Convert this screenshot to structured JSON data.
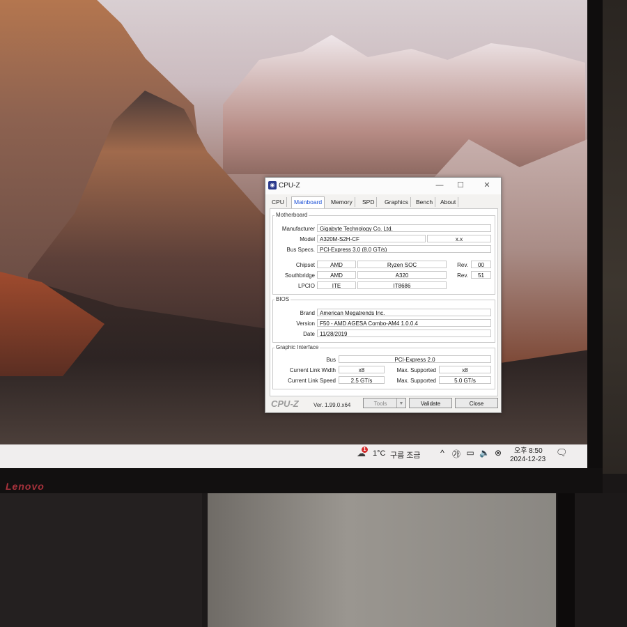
{
  "window": {
    "title": "CPU-Z",
    "app_icon": "cpuz-icon",
    "controls": {
      "minimize": "—",
      "maximize": "☐",
      "close": "✕"
    }
  },
  "tabs": [
    {
      "label": "CPU",
      "active": false
    },
    {
      "label": "Mainboard",
      "active": true
    },
    {
      "label": "Memory",
      "active": false
    },
    {
      "label": "SPD",
      "active": false
    },
    {
      "label": "Graphics",
      "active": false
    },
    {
      "label": "Bench",
      "active": false
    },
    {
      "label": "About",
      "active": false
    }
  ],
  "motherboard": {
    "title": "Motherboard",
    "manufacturer_label": "Manufacturer",
    "manufacturer": "Gigabyte Technology Co. Ltd.",
    "model_label": "Model",
    "model": "A320M-S2H-CF",
    "model_rev": "x.x",
    "bus_label": "Bus Specs.",
    "bus": "PCI-Express 3.0 (8.0 GT/s)",
    "chipset_label": "Chipset",
    "chipset_vendor": "AMD",
    "chipset_name": "Ryzen SOC",
    "rev_label": "Rev.",
    "chipset_rev": "00",
    "southbridge_label": "Southbridge",
    "southbridge_vendor": "AMD",
    "southbridge_name": "A320",
    "southbridge_rev": "51",
    "lpcio_label": "LPCIO",
    "lpcio_vendor": "ITE",
    "lpcio_name": "IT8686"
  },
  "bios": {
    "title": "BIOS",
    "brand_label": "Brand",
    "brand": "American Megatrends Inc.",
    "version_label": "Version",
    "version": "F50 - AMD AGESA Combo-AM4 1.0.0.4",
    "date_label": "Date",
    "date": "11/28/2019"
  },
  "graphic_interface": {
    "title": "Graphic Interface",
    "bus_label": "Bus",
    "bus": "PCI-Express 2.0",
    "link_width_label": "Current Link Width",
    "link_width": "x8",
    "max_supported_label": "Max. Supported",
    "max_link_width": "x8",
    "link_speed_label": "Current Link Speed",
    "link_speed": "2.5 GT/s",
    "max_link_speed": "5.0 GT/s"
  },
  "footer": {
    "logo": "CPU-Z",
    "version": "Ver. 1.99.0.x64",
    "tools": "Tools",
    "validate": "Validate",
    "close": "Close"
  },
  "taskbar": {
    "badge": "1",
    "temperature": "1°C",
    "weather": "구름 조금",
    "tray_icons": [
      "chevron-up-icon",
      "ime-icon",
      "network-icon",
      "volume-icon",
      "cancel-icon"
    ],
    "tray_glyphs": [
      "^",
      "㉮",
      "▭",
      "🔈",
      "⊗"
    ],
    "time": "오후 8:50",
    "date": "2024-12-23"
  },
  "monitor": {
    "brand": "Lenovo"
  },
  "colors": {
    "accent": "#1a4fd6",
    "titlebar": "#fbfbfb",
    "taskbar": "#f0eeee"
  }
}
